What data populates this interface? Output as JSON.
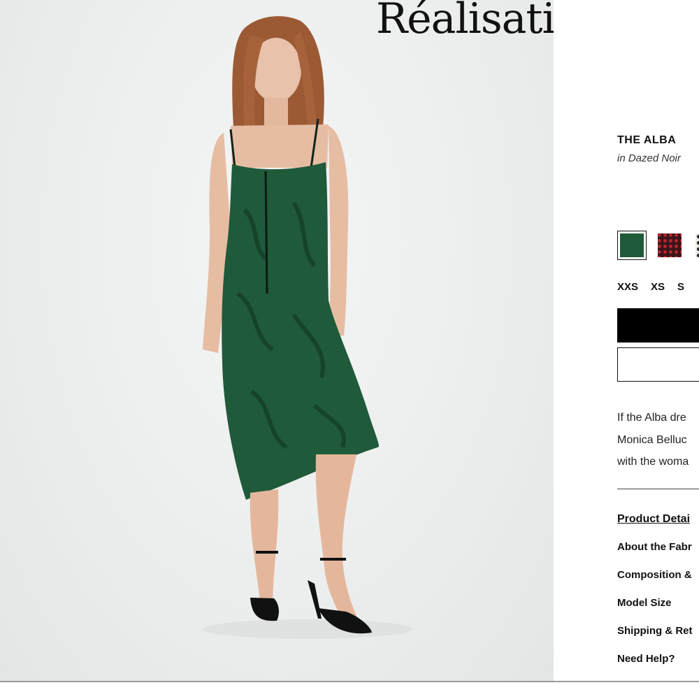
{
  "brand": {
    "logo_text": "Réalisation"
  },
  "product": {
    "name": "THE ALBA",
    "colour_label": "in Dazed Noir"
  },
  "swatches": [
    {
      "name": "green-paisley",
      "color": "#1f5a3a",
      "selected": true
    },
    {
      "name": "dark-red-floral",
      "color": "#3a1418",
      "selected": false
    },
    {
      "name": "white-dot",
      "color": "#efe9e4",
      "selected": false
    }
  ],
  "sizes": [
    "XXS",
    "XS",
    "S"
  ],
  "description_lines": [
    "If the Alba dre",
    "Monica Belluc",
    "with the woma"
  ],
  "accordion": [
    "Product Detai",
    "About the Fabr",
    "Composition &",
    "Model Size",
    "Shipping & Ret",
    "Need Help?"
  ],
  "colors": {
    "dress": "#1f5a3a",
    "accent_black": "#000000"
  }
}
